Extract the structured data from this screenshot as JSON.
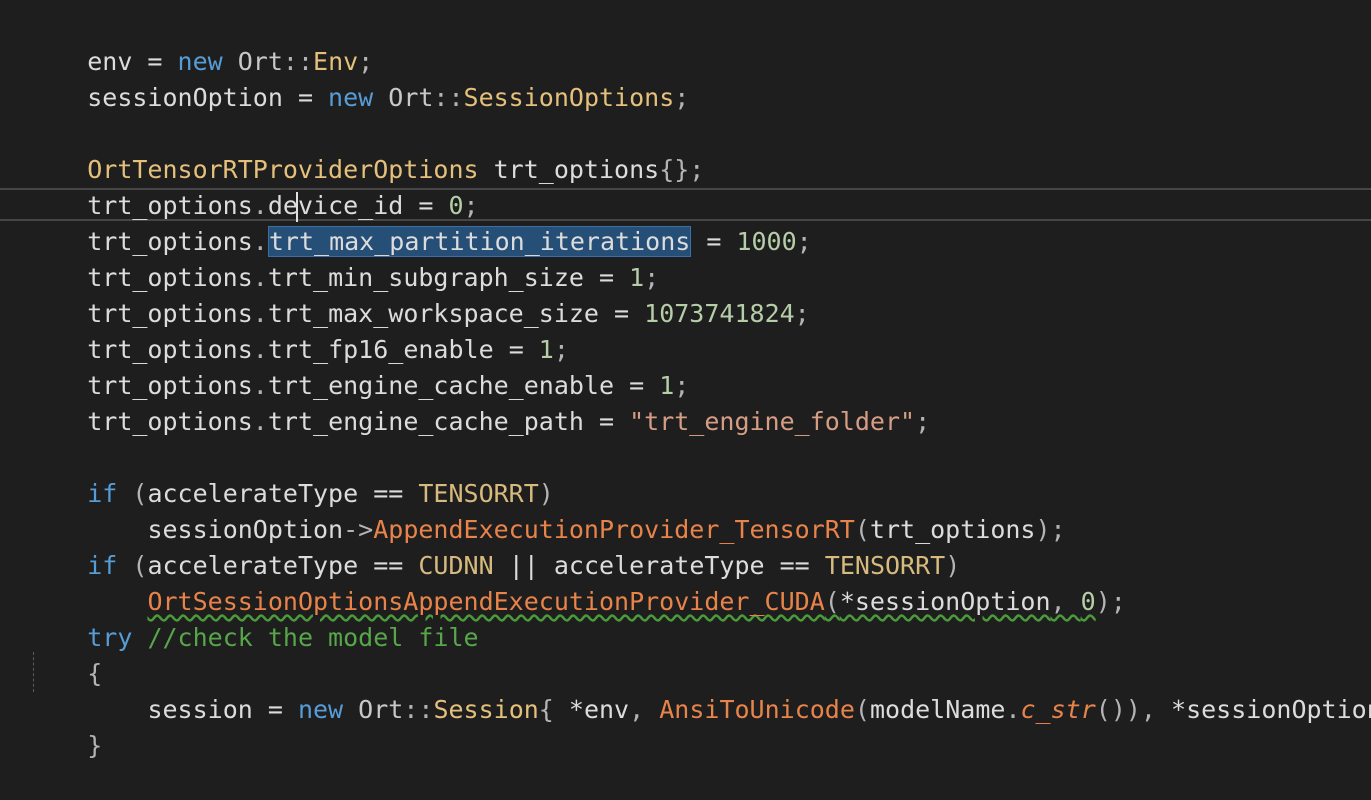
{
  "code": {
    "l1": [
      "env",
      " = ",
      "new",
      " ",
      "Ort",
      "::",
      "Env",
      ";"
    ],
    "l2": [
      "sessionOption",
      " = ",
      "new",
      " ",
      "Ort",
      "::",
      "SessionOptions",
      ";"
    ],
    "l4": [
      "OrtTensorRTProviderOptions",
      " trt_options",
      "{}",
      ";"
    ],
    "l5": [
      "trt_options",
      ".",
      "device_id",
      " = ",
      "0",
      ";"
    ],
    "l6": [
      "trt_options",
      ".",
      "trt_max_partition_iterations",
      " = ",
      "1000",
      ";"
    ],
    "l7": [
      "trt_options",
      ".",
      "trt_min_subgraph_size",
      " = ",
      "1",
      ";"
    ],
    "l8": [
      "trt_options",
      ".",
      "trt_max_workspace_size",
      " = ",
      "1073741824",
      ";"
    ],
    "l9": [
      "trt_options",
      ".",
      "trt_fp16_enable",
      " = ",
      "1",
      ";"
    ],
    "l10": [
      "trt_options",
      ".",
      "trt_engine_cache_enable",
      " = ",
      "1",
      ";"
    ],
    "l11": [
      "trt_options",
      ".",
      "trt_engine_cache_path",
      " = ",
      "\"trt_engine_folder\"",
      ";"
    ],
    "l13": [
      "if",
      " (",
      "accelerateType",
      " == ",
      "TENSORRT",
      ")"
    ],
    "l14": [
      "    ",
      "sessionOption",
      "->",
      "AppendExecutionProvider_TensorRT",
      "(",
      "trt_options",
      ");"
    ],
    "l15": [
      "if",
      " (",
      "accelerateType",
      " == ",
      "CUDNN",
      " || ",
      "accelerateType",
      " == ",
      "TENSORRT",
      ")"
    ],
    "l16": [
      "    ",
      "OrtSessionOptionsAppendExecutionProvider_CUDA",
      "(",
      "*sessionOption",
      ", ",
      "0",
      ");"
    ],
    "l17": [
      "try",
      " ",
      "//check the model file"
    ],
    "l18": [
      "{"
    ],
    "l19": [
      "    ",
      "session",
      " = ",
      "new",
      " ",
      "Ort",
      "::",
      "Session",
      "{ ",
      "*env",
      ", ",
      "AnsiToUnicode",
      "(",
      "modelName",
      ".",
      "c_str",
      "()), ",
      "*sessionOption",
      " };"
    ],
    "l20": [
      "}"
    ]
  },
  "colors": {
    "background": "#1e1e1e",
    "keyword": "#569cd6",
    "class": "#e5c07b",
    "function": "#e8834a",
    "comment": "#57a64a",
    "enum": "#b8d7a3",
    "selection": "#264f78"
  }
}
